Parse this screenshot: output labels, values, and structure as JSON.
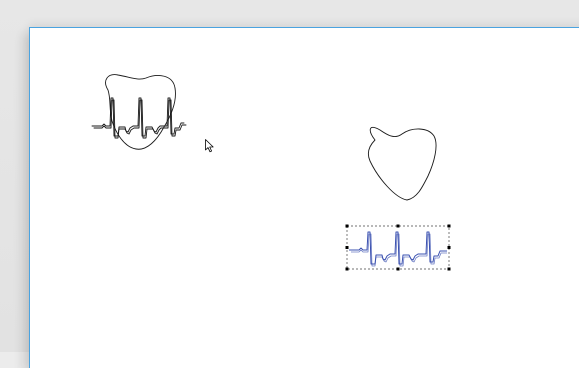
{
  "app": {
    "background_color": "#e6e6e6"
  },
  "canvas": {
    "background_color": "#ffffff",
    "border_color": "#4aa3e0"
  },
  "objects": {
    "heart_with_ecg": {
      "icon": "heart-with-ecg-icon",
      "stroke_color": "#1a1a1a"
    },
    "heart_shape": {
      "icon": "heart-outline-icon",
      "stroke_color": "#1a1a1a"
    },
    "ecg_waveform_selected": {
      "icon": "ecg-waveform-icon",
      "stroke_color": "#3a50b0",
      "selected": true,
      "selection_handle_color": "#000000"
    }
  },
  "cursor": {
    "icon": "arrow-cursor-icon"
  }
}
